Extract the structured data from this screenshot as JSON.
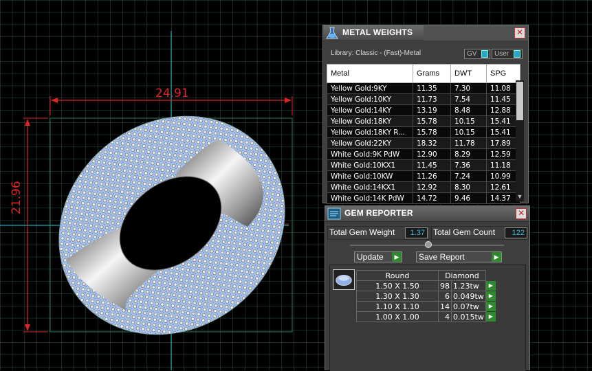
{
  "viewport": {
    "dimension_horizontal": "24.91",
    "dimension_vertical": "21.96",
    "colors": {
      "dimension": "#e02424",
      "grid": "#2f4f4f",
      "axis": "#1fa6b8",
      "gem": "#a8c4ec"
    }
  },
  "metal_weights": {
    "title": "METAL WEIGHTS",
    "library": "Library: Classic - (Fast)-Metal",
    "toggle_gv": "GV",
    "toggle_user": "User",
    "columns": [
      "Metal",
      "Grams",
      "DWT",
      "SPG"
    ],
    "rows": [
      [
        "Yellow Gold:9KY",
        "11.35",
        "7.30",
        "11.08"
      ],
      [
        "Yellow Gold:10KY",
        "11.73",
        "7.54",
        "11.45"
      ],
      [
        "Yellow Gold:14KY",
        "13.19",
        "8.48",
        "12.88"
      ],
      [
        "Yellow Gold:18KY",
        "15.78",
        "10.15",
        "15.41"
      ],
      [
        "Yellow Gold:18KY R...",
        "15.78",
        "10.15",
        "15.41"
      ],
      [
        "Yellow Gold:22KY",
        "18.32",
        "11.78",
        "17.89"
      ],
      [
        "White Gold:9K PdW",
        "12.90",
        "8.29",
        "12.59"
      ],
      [
        "White Gold:10KX1",
        "11.45",
        "7.36",
        "11.18"
      ],
      [
        "White Gold:10KW",
        "11.26",
        "7.24",
        "10.99"
      ],
      [
        "White Gold:14KX1",
        "12.92",
        "8.30",
        "12.61"
      ],
      [
        "White Gold:14K PdW",
        "14.72",
        "9.46",
        "14.37"
      ]
    ]
  },
  "gem_reporter": {
    "title": "GEM REPORTER",
    "total_weight_label": "Total Gem Weight",
    "total_weight_value": "1.37",
    "total_count_label": "Total Gem Count",
    "total_count_value": "122",
    "update_label": "Update",
    "save_label": "Save Report",
    "shape_header": "Round",
    "stone_header": "Diamond",
    "rows": [
      {
        "size": "1.50 X 1.50",
        "count": "98",
        "weight": "1.23tw"
      },
      {
        "size": "1.30 X 1.30",
        "count": "6",
        "weight": "0.049tw"
      },
      {
        "size": "1.10 X 1.10",
        "count": "14",
        "weight": "0.07tw"
      },
      {
        "size": "1.00 X 1.00",
        "count": "4",
        "weight": "0.015tw"
      }
    ]
  }
}
